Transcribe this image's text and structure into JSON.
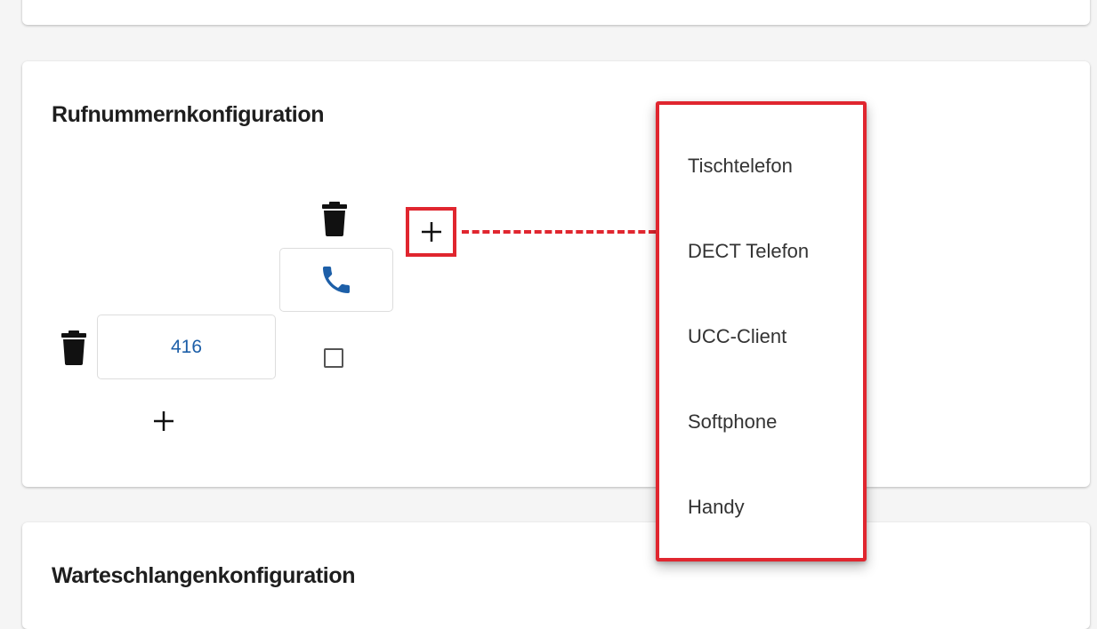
{
  "sections": {
    "number_config": {
      "title": "Rufnummernkonfiguration"
    },
    "queue_config": {
      "title": "Warteschlangenkonfiguration"
    }
  },
  "number_field": {
    "value": "416"
  },
  "icons": {
    "trash": "trash-icon",
    "phone": "phone-icon",
    "plus": "plus-icon",
    "checkbox": "checkbox-unchecked"
  },
  "device_menu": {
    "items": [
      {
        "label": "Tischtelefon"
      },
      {
        "label": "DECT Telefon"
      },
      {
        "label": "UCC-Client"
      },
      {
        "label": "Softphone"
      },
      {
        "label": "Handy"
      }
    ]
  },
  "colors": {
    "highlight": "#e0262f",
    "phone_icon": "#1d5fa8",
    "number_text": "#1d5fa8"
  }
}
